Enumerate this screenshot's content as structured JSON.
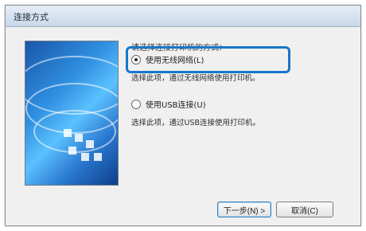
{
  "window": {
    "title": "连接方式"
  },
  "prompt": "请选择连接打印机的方式：",
  "options": [
    {
      "label": "使用无线网络(L)",
      "description": "选择此项，通过无线网络使用打印机。",
      "selected": true
    },
    {
      "label": "使用USB连接(U)",
      "description": "选择此项，通过USB连接使用打印机。",
      "selected": false
    }
  ],
  "buttons": {
    "next": "下一步(N) >",
    "cancel": "取消(C)"
  },
  "colors": {
    "accent": "#1877c9"
  }
}
